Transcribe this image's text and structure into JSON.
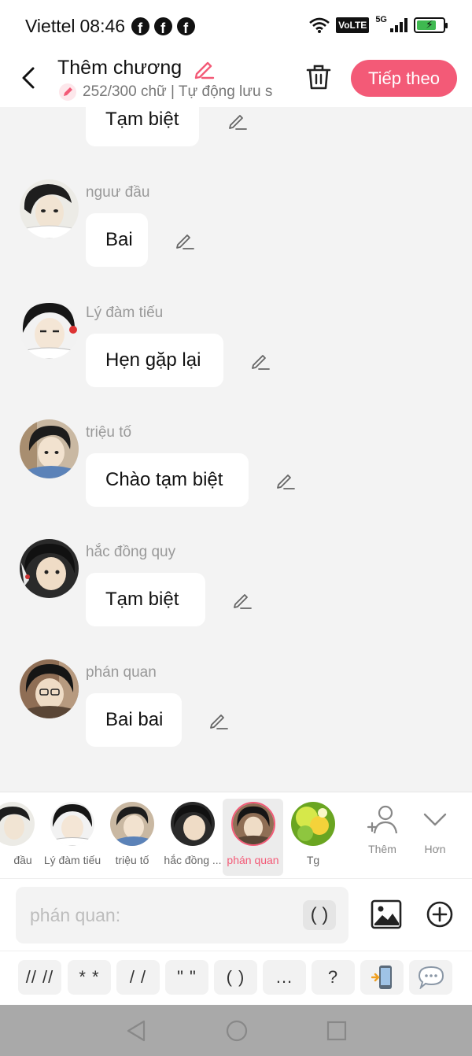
{
  "status_bar": {
    "carrier": "Viettel",
    "time": "08:46",
    "network": "VoLTE",
    "network_type": "5G"
  },
  "header": {
    "title": "Thêm chương",
    "subtitle": "252/300 chữ | Tự động lưu s",
    "next_label": "Tiếp theo"
  },
  "messages": [
    {
      "name": "",
      "text": "Tạm biệt"
    },
    {
      "name": "nguư đầu",
      "text": "Bai"
    },
    {
      "name": "Lý đàm tiếu",
      "text": "Hẹn gặp lại"
    },
    {
      "name": "triệu tố",
      "text": "Chào tạm biệt"
    },
    {
      "name": "hắc đồng quy",
      "text": "Tạm biệt"
    },
    {
      "name": "phán quan",
      "text": "Bai bai"
    }
  ],
  "characters": [
    {
      "label": "đầu"
    },
    {
      "label": "Lý đàm tiếu"
    },
    {
      "label": "triệu tố"
    },
    {
      "label": "hắc đồng ..."
    },
    {
      "label": "phán quan",
      "selected": true
    },
    {
      "label": "Tg"
    }
  ],
  "char_actions": {
    "add_label": "Thêm",
    "more_label": "Hơn"
  },
  "input": {
    "placeholder": "phán quan:",
    "paren_label": "( )"
  },
  "snippets": [
    "// //",
    "* *",
    "/ /",
    "\" \"",
    "( )",
    "...",
    "?"
  ],
  "colors": {
    "accent": "#f35a77",
    "background": "#f3f3f3",
    "bubble": "#ffffff",
    "name_text": "#999999"
  }
}
